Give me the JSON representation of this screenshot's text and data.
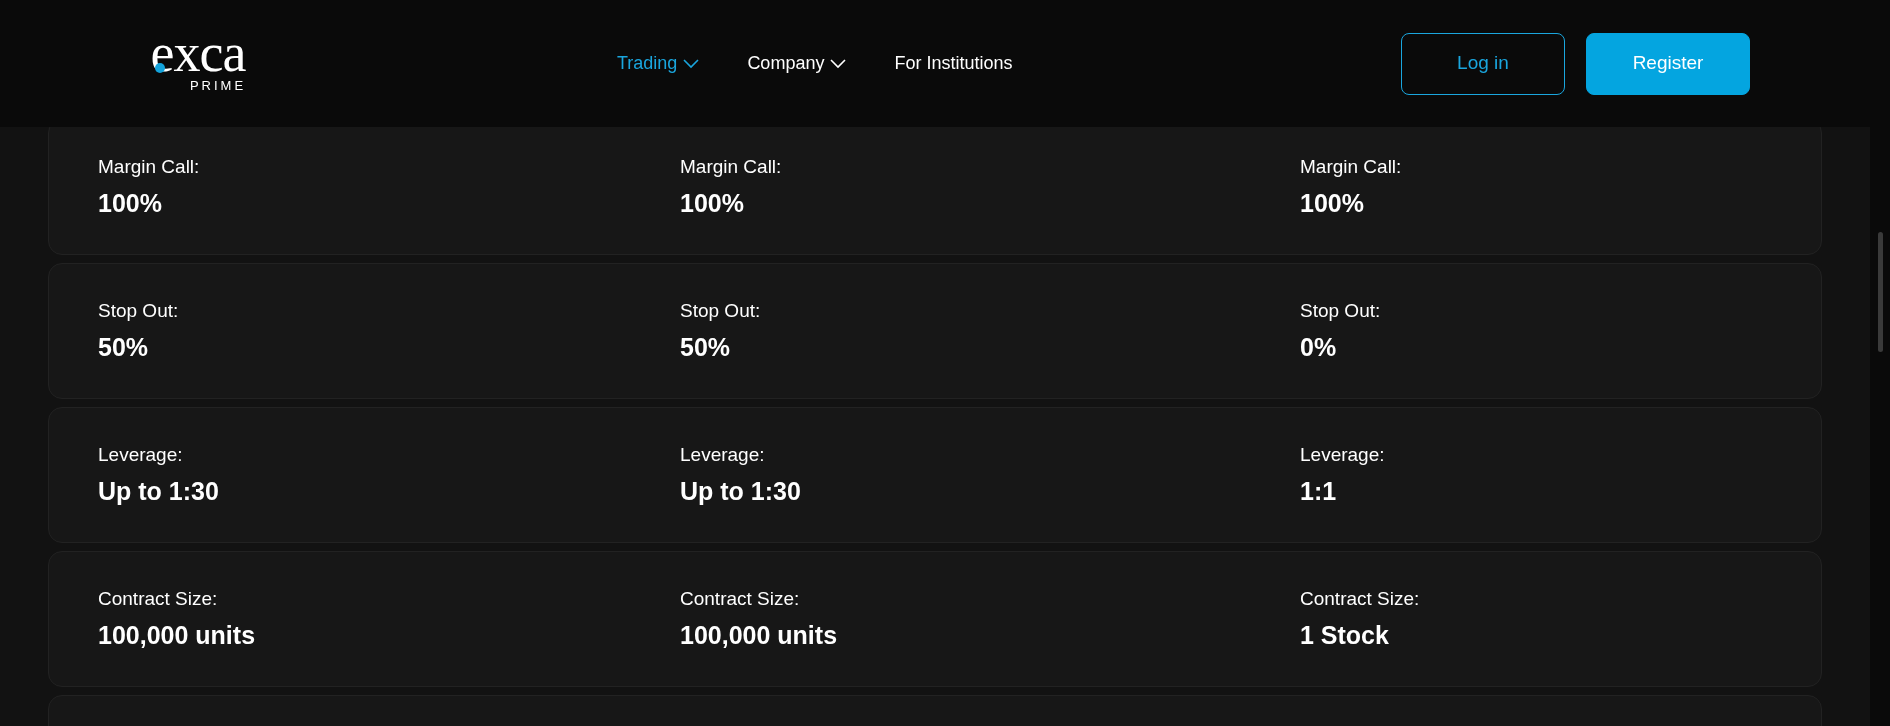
{
  "header": {
    "logo": {
      "wordmark": "exca",
      "subtitle": "PRIME"
    },
    "nav": [
      {
        "label": "Trading",
        "selected": true,
        "has_dropdown": true
      },
      {
        "label": "Company",
        "selected": false,
        "has_dropdown": true
      },
      {
        "label": "For Institutions",
        "selected": false,
        "has_dropdown": false
      }
    ],
    "buttons": [
      {
        "label": "Log in",
        "kind": "outline"
      },
      {
        "label": "Register",
        "kind": "filled"
      }
    ]
  },
  "rows": [
    {
      "cells": [
        {
          "label": "Margin Call:",
          "value": "100%"
        },
        {
          "label": "Margin Call:",
          "value": "100%"
        },
        {
          "label": "Margin Call:",
          "value": "100%"
        }
      ]
    },
    {
      "cells": [
        {
          "label": "Stop Out:",
          "value": "50%"
        },
        {
          "label": "Stop Out:",
          "value": "50%"
        },
        {
          "label": "Stop Out:",
          "value": "0%"
        }
      ]
    },
    {
      "cells": [
        {
          "label": "Leverage:",
          "value": "Up to 1:30"
        },
        {
          "label": "Leverage:",
          "value": "Up to 1:30"
        },
        {
          "label": "Leverage:",
          "value": "1:1"
        }
      ]
    },
    {
      "cells": [
        {
          "label": "Contract Size:",
          "value": "100,000 units"
        },
        {
          "label": "Contract Size:",
          "value": "100,000 units"
        },
        {
          "label": "Contract Size:",
          "value": "1 Stock"
        }
      ]
    },
    {
      "cells": []
    }
  ]
}
